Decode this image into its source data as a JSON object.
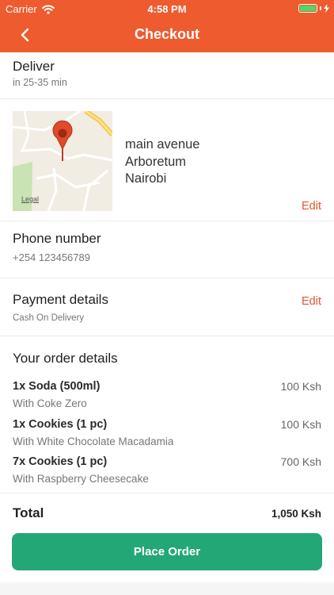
{
  "status_bar": {
    "carrier": "Carrier",
    "time": "4:58 PM"
  },
  "header": {
    "title": "Checkout",
    "back_icon": "chevron-left-icon"
  },
  "deliver": {
    "title": "Deliver",
    "eta": "in 25-35 min"
  },
  "address": {
    "lines": [
      "main avenue",
      "Arboretum",
      "Nairobi"
    ],
    "edit_label": "Edit",
    "map_label": "Legal",
    "pin_icon": "map-pin-icon"
  },
  "phone": {
    "title": "Phone number",
    "value": "+254 123456789"
  },
  "payment": {
    "title": "Payment details",
    "method": "Cash On Delivery",
    "edit_label": "Edit"
  },
  "order": {
    "title": "Your order details",
    "items": [
      {
        "name": "1x Soda (500ml)",
        "desc": "With Coke Zero",
        "price": "100 Ksh"
      },
      {
        "name": "1x Cookies (1 pc)",
        "desc": "With White Chocolate Macadamia",
        "price": "100 Ksh"
      },
      {
        "name": "7x Cookies (1 pc)",
        "desc": "With Raspberry Cheesecake",
        "price": "700 Ksh"
      }
    ]
  },
  "total": {
    "label": "Total",
    "value": "1,050 Ksh"
  },
  "place_order": {
    "label": "Place Order"
  },
  "colors": {
    "brand": "#ee5b2f",
    "accent": "#e5542a",
    "button": "#23a776"
  }
}
